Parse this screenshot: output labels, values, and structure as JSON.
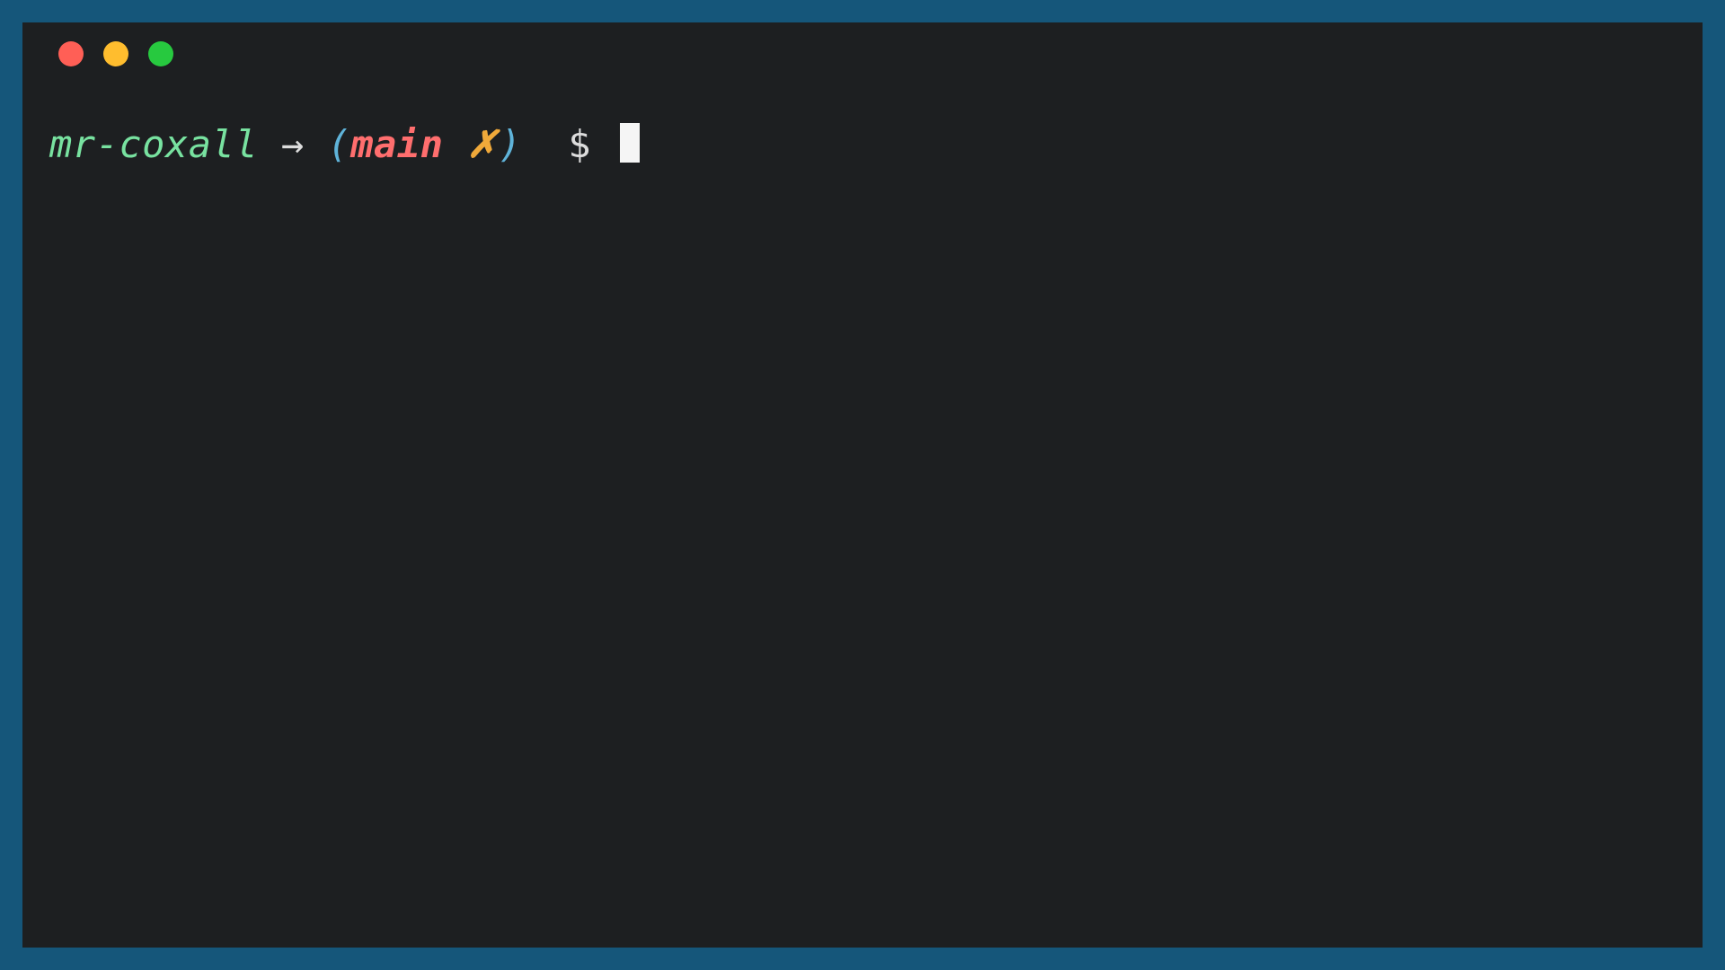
{
  "prompt": {
    "user": "mr-coxall",
    "arrow": "→",
    "paren_open": "(",
    "branch": "main",
    "status_glyph": "✗",
    "paren_close": ")",
    "symbol": "$"
  },
  "command": "",
  "colors": {
    "frame": "#15567a",
    "bg": "#1d1f21",
    "user": "#78e2a0",
    "paren": "#5fb3d9",
    "branch": "#ff6e6e",
    "status": "#f0a93a",
    "text": "#dcdcdc",
    "close_btn": "#ff5f56",
    "min_btn": "#ffbd2e",
    "zoom_btn": "#27c93f"
  }
}
